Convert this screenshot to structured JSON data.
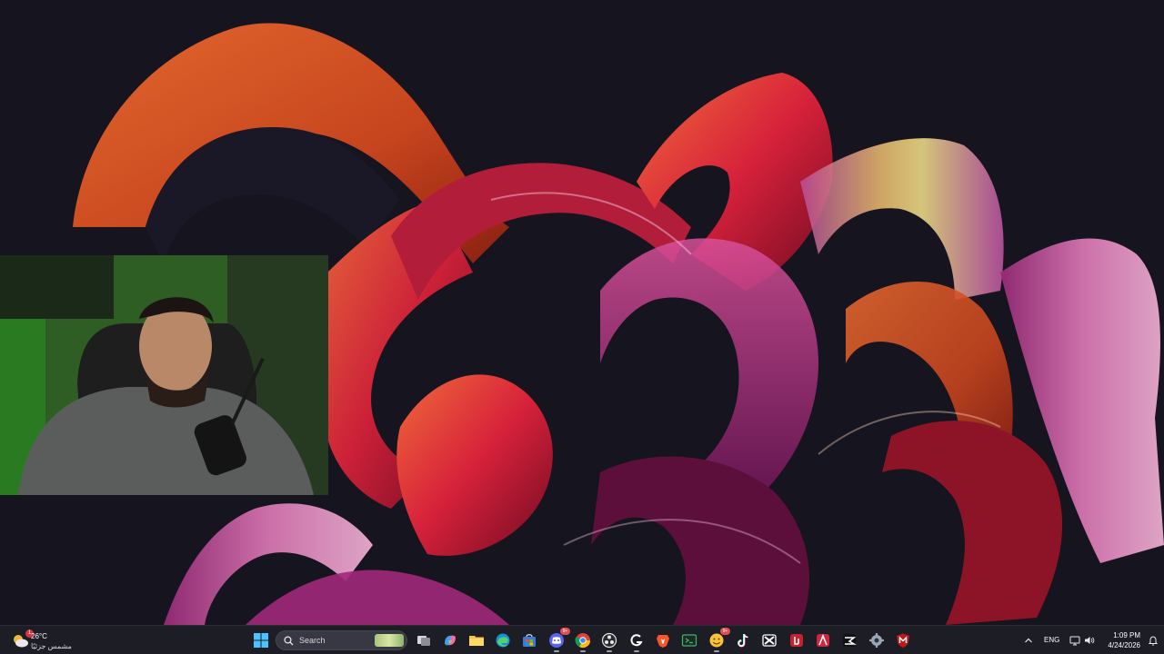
{
  "taskbar": {
    "weather": {
      "temperature": "26°C",
      "condition": "مشمس جزئيًا",
      "badge": "1"
    },
    "search": {
      "label": "Search"
    },
    "apps": [
      {
        "name": "start-button",
        "icon": "windows-logo-icon"
      },
      {
        "name": "search-box",
        "icon": "search-icon"
      },
      {
        "name": "task-view-button",
        "icon": "task-view-icon"
      },
      {
        "name": "copilot-button",
        "icon": "copilot-icon"
      },
      {
        "name": "file-explorer-button",
        "icon": "folder-icon"
      },
      {
        "name": "edge-button",
        "icon": "edge-icon"
      },
      {
        "name": "store-button",
        "icon": "store-icon"
      },
      {
        "name": "discord-button",
        "icon": "discord-icon",
        "badge": "9+"
      },
      {
        "name": "chrome-button",
        "icon": "chrome-icon"
      },
      {
        "name": "obs-button",
        "icon": "obs-icon"
      },
      {
        "name": "ghub-button",
        "icon": "logitech-g-icon"
      },
      {
        "name": "brave-button",
        "icon": "brave-icon"
      },
      {
        "name": "terminal-button",
        "icon": "terminal-icon"
      },
      {
        "name": "emoji-app-button",
        "icon": "emoji-icon",
        "badge": "9+"
      },
      {
        "name": "tiktok-button",
        "icon": "tiktok-icon"
      },
      {
        "name": "capcut-button",
        "icon": "capcut-icon"
      },
      {
        "name": "red-app-button",
        "icon": "red-app-icon"
      },
      {
        "name": "affinity-button",
        "icon": "affinity-icon"
      },
      {
        "name": "capcut-black-button",
        "icon": "capcut-black-icon"
      },
      {
        "name": "settings-button",
        "icon": "gear-icon"
      },
      {
        "name": "mcafee-button",
        "icon": "mcafee-icon"
      }
    ],
    "tray": {
      "language": "ENG",
      "time": "1:09 PM",
      "date": "4/24/2026"
    }
  },
  "colors": {
    "taskbar_bg": "#1e1e26",
    "wallpaper_bg": "#15141f",
    "accent_windows": "#4cc2ff"
  }
}
